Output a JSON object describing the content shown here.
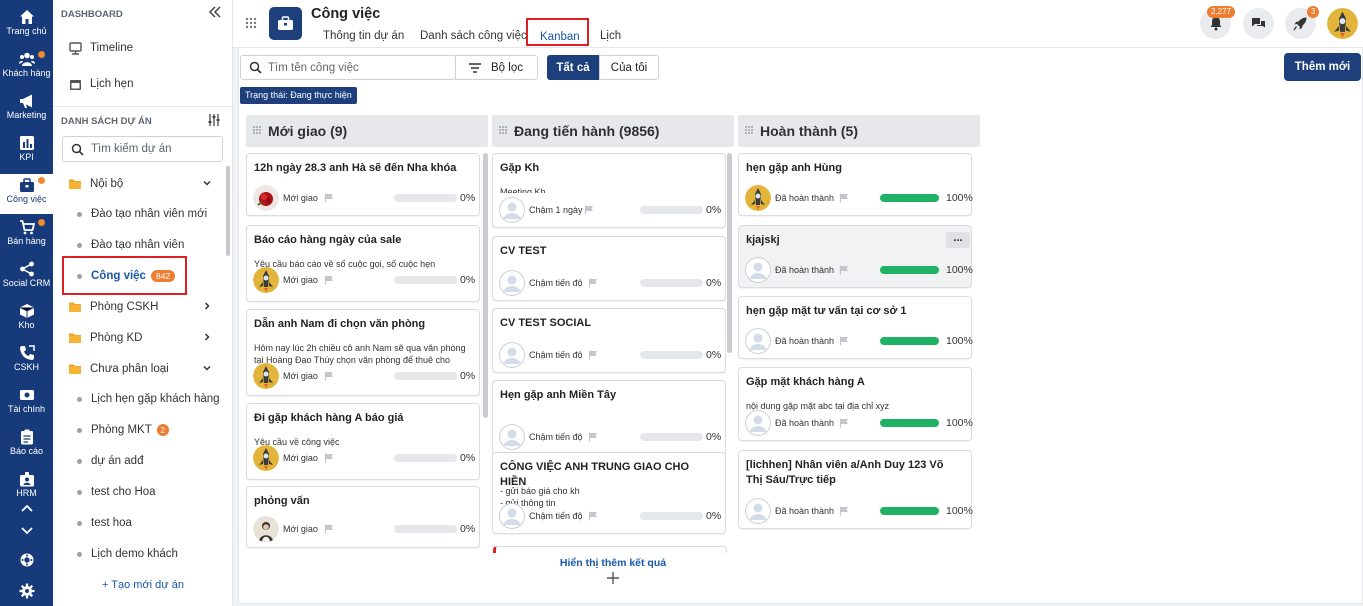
{
  "rail": {
    "items": [
      {
        "label": "Trang chủ",
        "icon": "home-icon"
      },
      {
        "label": "Khách hàng",
        "icon": "users-icon",
        "dot": true
      },
      {
        "label": "Marketing",
        "icon": "megaphone-icon"
      },
      {
        "label": "KPI",
        "icon": "chart-icon"
      },
      {
        "label": "Công việc",
        "icon": "briefcase-icon",
        "dot": true,
        "active": true
      },
      {
        "label": "Bán hàng",
        "icon": "cart-icon",
        "dot": true
      },
      {
        "label": "Social CRM",
        "icon": "share-icon"
      },
      {
        "label": "Kho",
        "icon": "box-icon"
      },
      {
        "label": "CSKH",
        "icon": "phone-icon"
      },
      {
        "label": "Tài chính",
        "icon": "money-icon"
      },
      {
        "label": "Báo cáo",
        "icon": "report-icon"
      },
      {
        "label": "HRM",
        "icon": "hrm-icon"
      }
    ]
  },
  "panel": {
    "dashboard_label": "DASHBOARD",
    "timeline": "Timeline",
    "calendar": "Lịch hẹn",
    "projects_label": "DANH SÁCH DỰ ÁN",
    "search_placeholder": "Tìm kiếm dự án",
    "groups": [
      {
        "label": "Nội bộ",
        "open": true
      },
      {
        "label": "Phòng CSKH"
      },
      {
        "label": "Phòng KD"
      },
      {
        "label": "Chưa phân loại",
        "open": true
      }
    ],
    "noi_bo_items": [
      {
        "label": "Đào tạo nhân viên mới"
      },
      {
        "label": "Đào tạo nhân viên"
      },
      {
        "label": "Công việc",
        "badge": "842",
        "active": true
      }
    ],
    "other_items": [
      {
        "label": "Lịch hẹn gặp khách hàng"
      },
      {
        "label": "Phòng MKT",
        "badge": "2"
      },
      {
        "label": "dự án adđ"
      },
      {
        "label": "test cho Hoa"
      },
      {
        "label": "test hoa"
      },
      {
        "label": "Lịch demo khách"
      }
    ],
    "new_project": "+ Tạo mới dự án"
  },
  "header": {
    "title": "Công việc",
    "tabs": [
      {
        "label": "Thông tin dự án"
      },
      {
        "label": "Danh sách công việc"
      },
      {
        "label": "Kanban",
        "active": true
      },
      {
        "label": "Lịch"
      }
    ],
    "notif_count": "2,277",
    "rocket_count": "3"
  },
  "toolbar": {
    "search_placeholder": "Tìm tên công việc",
    "filter_label": "Bộ lọc",
    "all_label": "Tất cả",
    "mine_label": "Của tôi",
    "add_label": "Thêm mới",
    "status_chip": "Trạng thái: Đang thực hiện"
  },
  "columns": [
    {
      "title": "Mới giao (9)",
      "cards": [
        {
          "title": "12h ngày 28.3 anh Hà sẽ đến Nha khóa",
          "desc": "",
          "status": "Mới giao",
          "percent": "0%",
          "avatar": "rose"
        },
        {
          "title": "Báo cáo hàng ngày của sale",
          "desc": "Yêu cầu báo cáo về số cuộc gọi, số cuộc hẹn",
          "status": "Mới giao",
          "percent": "0%",
          "avatar": "astro"
        },
        {
          "title": "Dẫn anh Nam đi chọn văn phòng",
          "desc": "Hôm nay lúc 2h chiều cô anh Nam sẽ qua văn phòng tại Hoàng Đạo Thúy chọn văn phòng để thuê cho cô...",
          "status": "Mới giao",
          "percent": "0%",
          "avatar": "astro"
        },
        {
          "title": "Đi gặp khách hàng A báo giá",
          "desc": "Yêu cầu về công việc",
          "status": "Mới giao",
          "percent": "0%",
          "avatar": "astro"
        },
        {
          "title": "phỏng vấn",
          "desc": "",
          "status": "Mới giao",
          "percent": "0%",
          "avatar": "person"
        }
      ]
    },
    {
      "title": "Đang tiến hành (9856)",
      "cards": [
        {
          "title": "Gặp Kh",
          "desc": "Meeting Kh",
          "status": "Chậm 1 ngày",
          "percent": "0%",
          "avatar": "blank"
        },
        {
          "title": "CV TEST",
          "desc": "",
          "status": "Chậm tiến độ",
          "percent": "0%",
          "avatar": "blank"
        },
        {
          "title": "CV TEST SOCIAL",
          "desc": "",
          "status": "Chậm tiến độ",
          "percent": "0%",
          "avatar": "blank"
        },
        {
          "title": "Hẹn gặp anh Miền Tây",
          "desc": "",
          "status": "Chậm tiến độ",
          "percent": "0%",
          "avatar": "blank"
        },
        {
          "title": "CÔNG VIỆC ANH TRUNG GIAO CHO HIỀN",
          "desc": "- gửi báo giá cho kh\n- gửi thông tin",
          "status": "Chậm tiến độ",
          "percent": "0%",
          "avatar": "blank"
        }
      ],
      "show_more": "Hiển thị thêm kết quả"
    },
    {
      "title": "Hoàn thành (5)",
      "cards": [
        {
          "title": "hẹn gặp anh Hùng",
          "desc": "",
          "status": "Đã hoàn thành",
          "percent": "100%",
          "avatar": "astro"
        },
        {
          "title": "kjajskj",
          "desc": "",
          "status": "Đã hoàn thành",
          "percent": "100%",
          "avatar": "blank",
          "more": "..."
        },
        {
          "title": "hẹn gặp mặt tư vấn tại cơ sở 1",
          "desc": "",
          "status": "Đã hoàn thành",
          "percent": "100%",
          "avatar": "blank"
        },
        {
          "title": "Gặp mặt khách hàng A",
          "desc": "nội dung gặp mặt abc tại địa chỉ xyz",
          "status": "Đã hoàn thành",
          "percent": "100%",
          "avatar": "blank"
        },
        {
          "title": "[lichhen] Nhân viên a/Anh Duy 123 Võ Thị Sáu/Trực tiếp",
          "desc": "",
          "status": "Đã hoàn thành",
          "percent": "100%",
          "avatar": "blank"
        }
      ]
    }
  ],
  "colors": {
    "rail": "#163a7a",
    "primary": "#1d3f7c",
    "accent": "#ed7d31",
    "done": "#1fb264",
    "highlight": "#e01e26"
  }
}
